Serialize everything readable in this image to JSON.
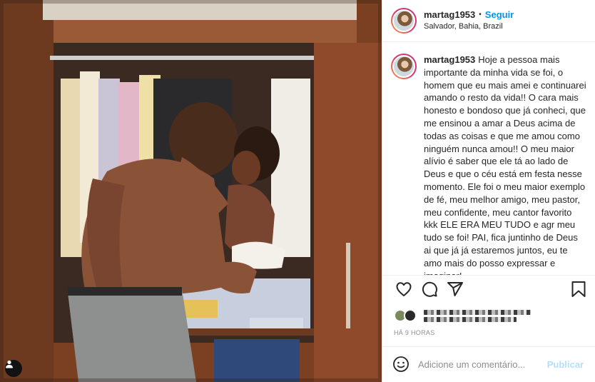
{
  "post": {
    "photo_alt": "",
    "author": {
      "username": "martag1953",
      "follow_label": "Seguir",
      "separator": "•",
      "location": "Salvador, Bahia, Brazil"
    },
    "caption": {
      "username": "martag1953",
      "text": "Hoje a pessoa mais importante da minha vida se foi, o homem que eu mais amei e continuarei amando o resto da vida!! O cara mais honesto e bondoso que já conheci, que me ensinou a amar a Deus acima de todas as coisas e que me amou como ninguém nunca amou!! O meu maior alívio é saber que ele tá ao lado de Deus e que o céu está em festa nesse momento. Ele foi o meu maior exemplo de fé, meu melhor amigo, meu pastor, meu confidente, meu cantor favorito kkk ELE ERA MEU TUDO e agr meu tudo se foi! PAI, fica juntinho de Deus ai que já já estaremos juntos, eu te amo mais do posso expressar e imaginar!"
    },
    "actions": {
      "like_icon": "heart-icon",
      "comment_icon": "comment-icon",
      "share_icon": "share-icon",
      "save_icon": "bookmark-icon"
    },
    "timestamp": "HÁ 9 HORAS",
    "add_comment": {
      "placeholder": "Adicione um comentário...",
      "publish_label": "Publicar"
    }
  },
  "colors": {
    "accent": "#0095f6",
    "publish_disabled": "#b2dffc",
    "muted": "#8e8e8e",
    "border": "#efefef"
  }
}
